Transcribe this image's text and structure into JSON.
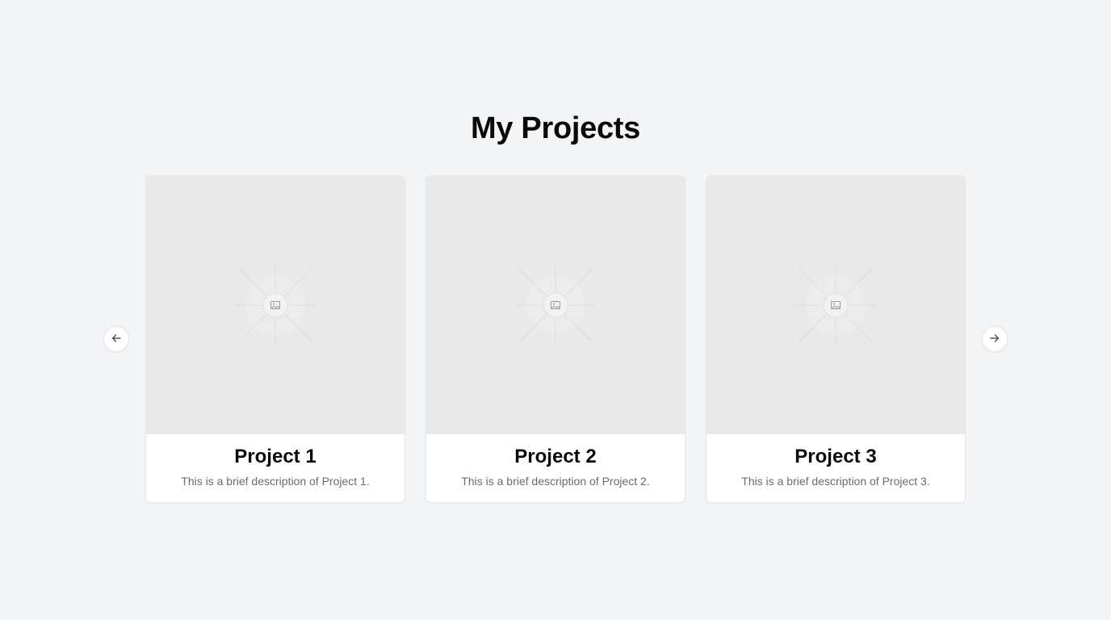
{
  "page": {
    "title": "My Projects"
  },
  "carousel": {
    "prev_icon": "arrow-left-icon",
    "next_icon": "arrow-right-icon",
    "projects": [
      {
        "title": "Project 1",
        "description": "This is a brief description of Project 1.",
        "image_icon": "image-placeholder-icon"
      },
      {
        "title": "Project 2",
        "description": "This is a brief description of Project 2.",
        "image_icon": "image-placeholder-icon"
      },
      {
        "title": "Project 3",
        "description": "This is a brief description of Project 3.",
        "image_icon": "image-placeholder-icon"
      }
    ]
  },
  "colors": {
    "background": "#f3f4f6",
    "card": "#ffffff",
    "image_placeholder": "#e9e9e9",
    "title_text": "#0a0a0a",
    "muted_text": "#6b6b6b"
  }
}
